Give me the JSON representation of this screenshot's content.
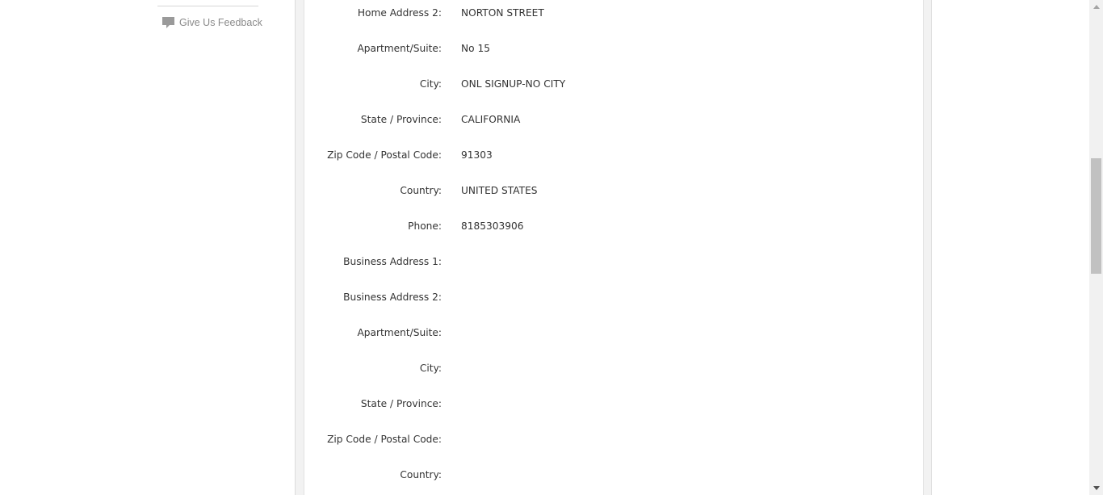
{
  "sidebar": {
    "feedback_label": "Give Us Feedback",
    "feedback_icon": "speech-bubble-icon"
  },
  "profile_fields": [
    {
      "label": "Home Address 2:",
      "value": "NORTON STREET"
    },
    {
      "label": "Apartment/Suite:",
      "value": "No 15"
    },
    {
      "label": "City:",
      "value": "ONL SIGNUP-NO CITY"
    },
    {
      "label": "State / Province:",
      "value": "CALIFORNIA"
    },
    {
      "label": "Zip Code / Postal Code:",
      "value": "91303"
    },
    {
      "label": "Country:",
      "value": "UNITED STATES"
    },
    {
      "label": "Phone:",
      "value": "8185303906"
    },
    {
      "label": "Business Address 1:",
      "value": ""
    },
    {
      "label": "Business Address 2:",
      "value": ""
    },
    {
      "label": "Apartment/Suite:",
      "value": ""
    },
    {
      "label": "City:",
      "value": ""
    },
    {
      "label": "State / Province:",
      "value": ""
    },
    {
      "label": "Zip Code / Postal Code:",
      "value": ""
    },
    {
      "label": "Country:",
      "value": ""
    }
  ],
  "colors": {
    "label_text": "#333333",
    "feedback_text": "#8a8a8a",
    "panel_background": "#f2f2f2"
  }
}
